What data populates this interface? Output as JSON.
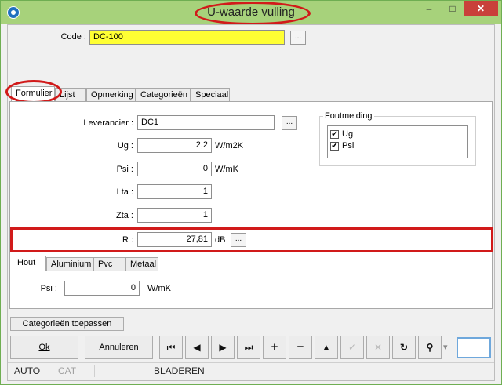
{
  "window": {
    "title": "U-waarde vulling",
    "minimize": "–",
    "maximize": "□",
    "close": "✕"
  },
  "code": {
    "label": "Code :",
    "value": "DC-100",
    "browse": "..."
  },
  "tabs": [
    "Formulier",
    "Lijst",
    "Opmerking",
    "Categorieën",
    "Speciaal"
  ],
  "form": {
    "leverancier": {
      "label": "Leverancier :",
      "value": "DC1",
      "browse": "..."
    },
    "ug": {
      "label": "Ug :",
      "value": "2,2",
      "unit": "W/m2K"
    },
    "psi": {
      "label": "Psi :",
      "value": "0",
      "unit": "W/mK"
    },
    "lta": {
      "label": "Lta :",
      "value": "1"
    },
    "zta": {
      "label": "Zta :",
      "value": "1"
    },
    "r": {
      "label": "R :",
      "value": "27,81",
      "unit": "dB",
      "browse": "..."
    }
  },
  "foutmelding": {
    "title": "Foutmelding",
    "items": [
      {
        "label": "Ug",
        "checked": "✔"
      },
      {
        "label": "Psi",
        "checked": "✔"
      }
    ]
  },
  "subtabs": [
    "Hout",
    "Aluminium",
    "Pvc",
    "Metaal"
  ],
  "hout": {
    "psi_label": "Psi :",
    "psi_value": "0",
    "psi_unit": "W/mK"
  },
  "apply_button": "Categorieën toepassen",
  "buttons": {
    "ok": "Ok",
    "cancel": "Annuleren"
  },
  "nav": {
    "first": "⏮",
    "prev": "◀",
    "next": "▶",
    "last": "⏭",
    "add": "+",
    "remove": "−",
    "up": "▲",
    "edit": "✓",
    "delete": "✕",
    "refresh": "↻",
    "find": "⚲",
    "find_dropdown": "▾"
  },
  "status": {
    "mode": "AUTO",
    "cat": "CAT",
    "state": "BLADEREN"
  }
}
